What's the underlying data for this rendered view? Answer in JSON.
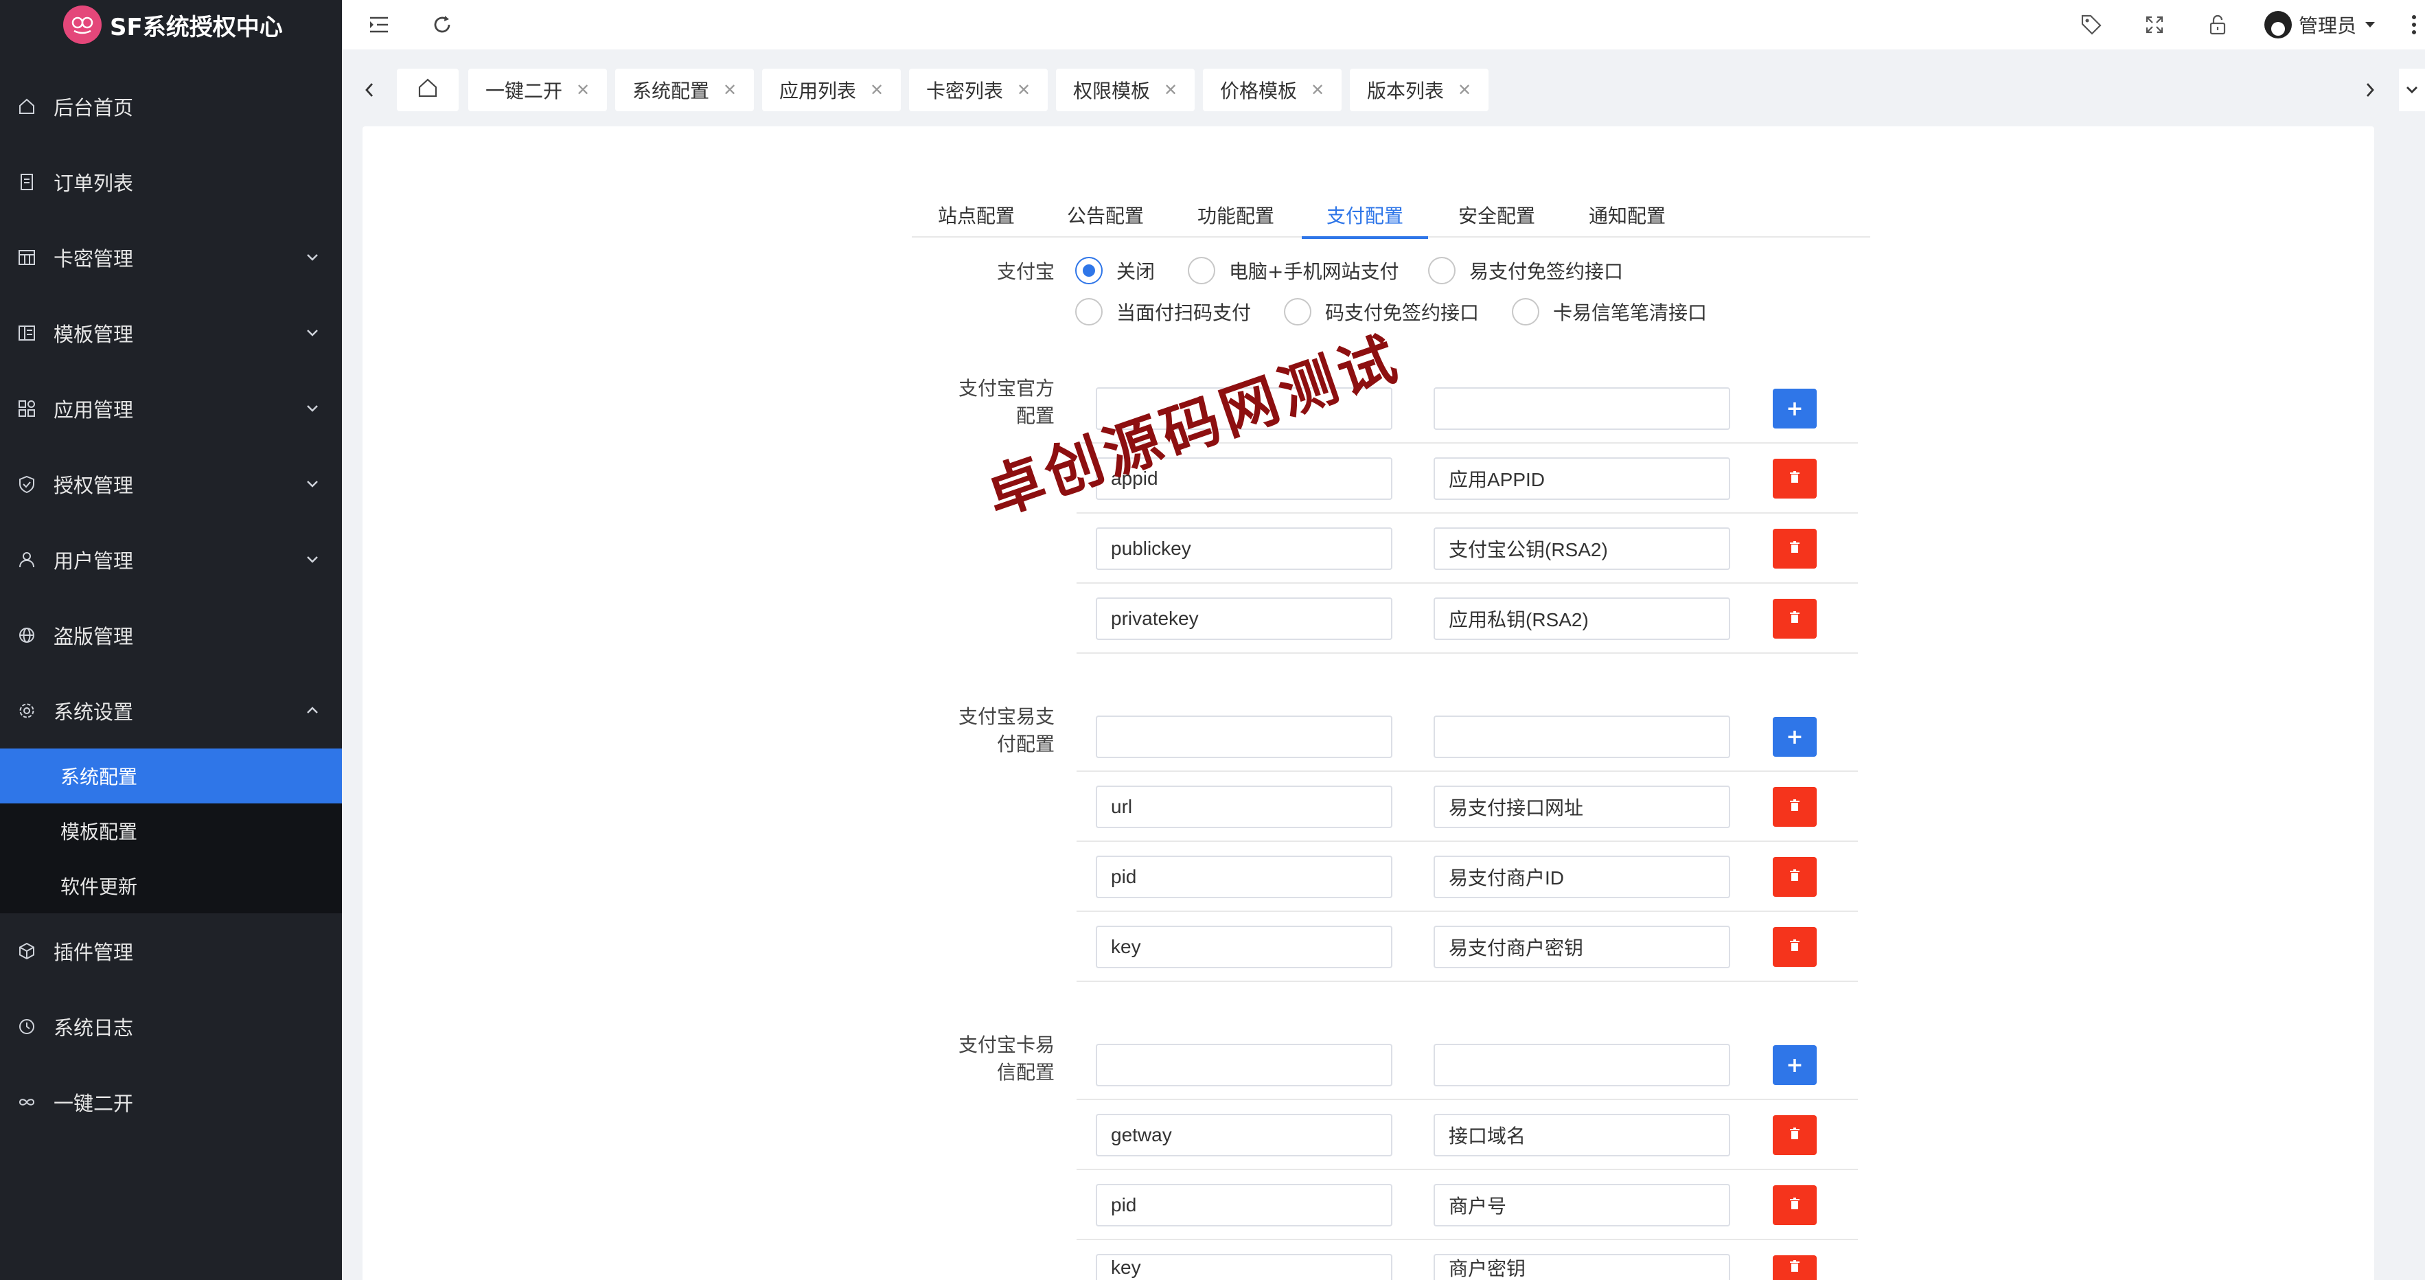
{
  "sidebar": {
    "brand": "SF系统授权中心",
    "items": [
      {
        "label": "后台首页",
        "icon": "home-icon"
      },
      {
        "label": "订单列表",
        "icon": "document-icon"
      },
      {
        "label": "卡密管理",
        "icon": "grid-icon"
      },
      {
        "label": "模板管理",
        "icon": "layout-icon"
      },
      {
        "label": "应用管理",
        "icon": "apps-icon"
      },
      {
        "label": "授权管理",
        "icon": "shield-icon"
      },
      {
        "label": "用户管理",
        "icon": "user-icon"
      },
      {
        "label": "盗版管理",
        "icon": "globe-icon"
      },
      {
        "label": "系统设置",
        "icon": "gear-icon"
      }
    ],
    "submenu": [
      {
        "label": "系统配置"
      },
      {
        "label": "模板配置"
      },
      {
        "label": "软件更新"
      }
    ],
    "bottom_items": [
      {
        "label": "插件管理",
        "icon": "cube-icon"
      },
      {
        "label": "系统日志",
        "icon": "clock-icon"
      },
      {
        "label": "一键二开",
        "icon": "infinity-icon"
      }
    ]
  },
  "topbar": {
    "user_label": "管理员"
  },
  "tabs": [
    {
      "label": "一键二开"
    },
    {
      "label": "系统配置"
    },
    {
      "label": "应用列表"
    },
    {
      "label": "卡密列表"
    },
    {
      "label": "权限模板"
    },
    {
      "label": "价格模板"
    },
    {
      "label": "版本列表"
    }
  ],
  "config_tabs": [
    {
      "label": "站点配置"
    },
    {
      "label": "公告配置"
    },
    {
      "label": "功能配置"
    },
    {
      "label": "支付配置"
    },
    {
      "label": "安全配置"
    },
    {
      "label": "通知配置"
    }
  ],
  "alipay": {
    "label": "支付宝",
    "options": [
      "关闭",
      "电脑+手机网站支付",
      "易支付免签约接口",
      "当面付扫码支付",
      "码支付免签约接口",
      "卡易信笔笔清接口"
    ],
    "selected": "关闭"
  },
  "sections": [
    {
      "label_line1": "支付宝官方",
      "label_line2": "配置",
      "rows": [
        {
          "key": "appid",
          "desc": "应用APPID"
        },
        {
          "key": "publickey",
          "desc": "支付宝公钥(RSA2)"
        },
        {
          "key": "privatekey",
          "desc": "应用私钥(RSA2)"
        }
      ]
    },
    {
      "label_line1": "支付宝易支",
      "label_line2": "付配置",
      "rows": [
        {
          "key": "url",
          "desc": "易支付接口网址"
        },
        {
          "key": "pid",
          "desc": "易支付商户ID"
        },
        {
          "key": "key",
          "desc": "易支付商户密钥"
        }
      ]
    },
    {
      "label_line1": "支付宝卡易",
      "label_line2": "信配置",
      "rows": [
        {
          "key": "getway",
          "desc": "接口域名"
        },
        {
          "key": "pid",
          "desc": "商户号"
        },
        {
          "key": "key",
          "desc": "商户密钥"
        }
      ]
    }
  ],
  "add_button": "+",
  "watermark": "卓创源码网测试"
}
